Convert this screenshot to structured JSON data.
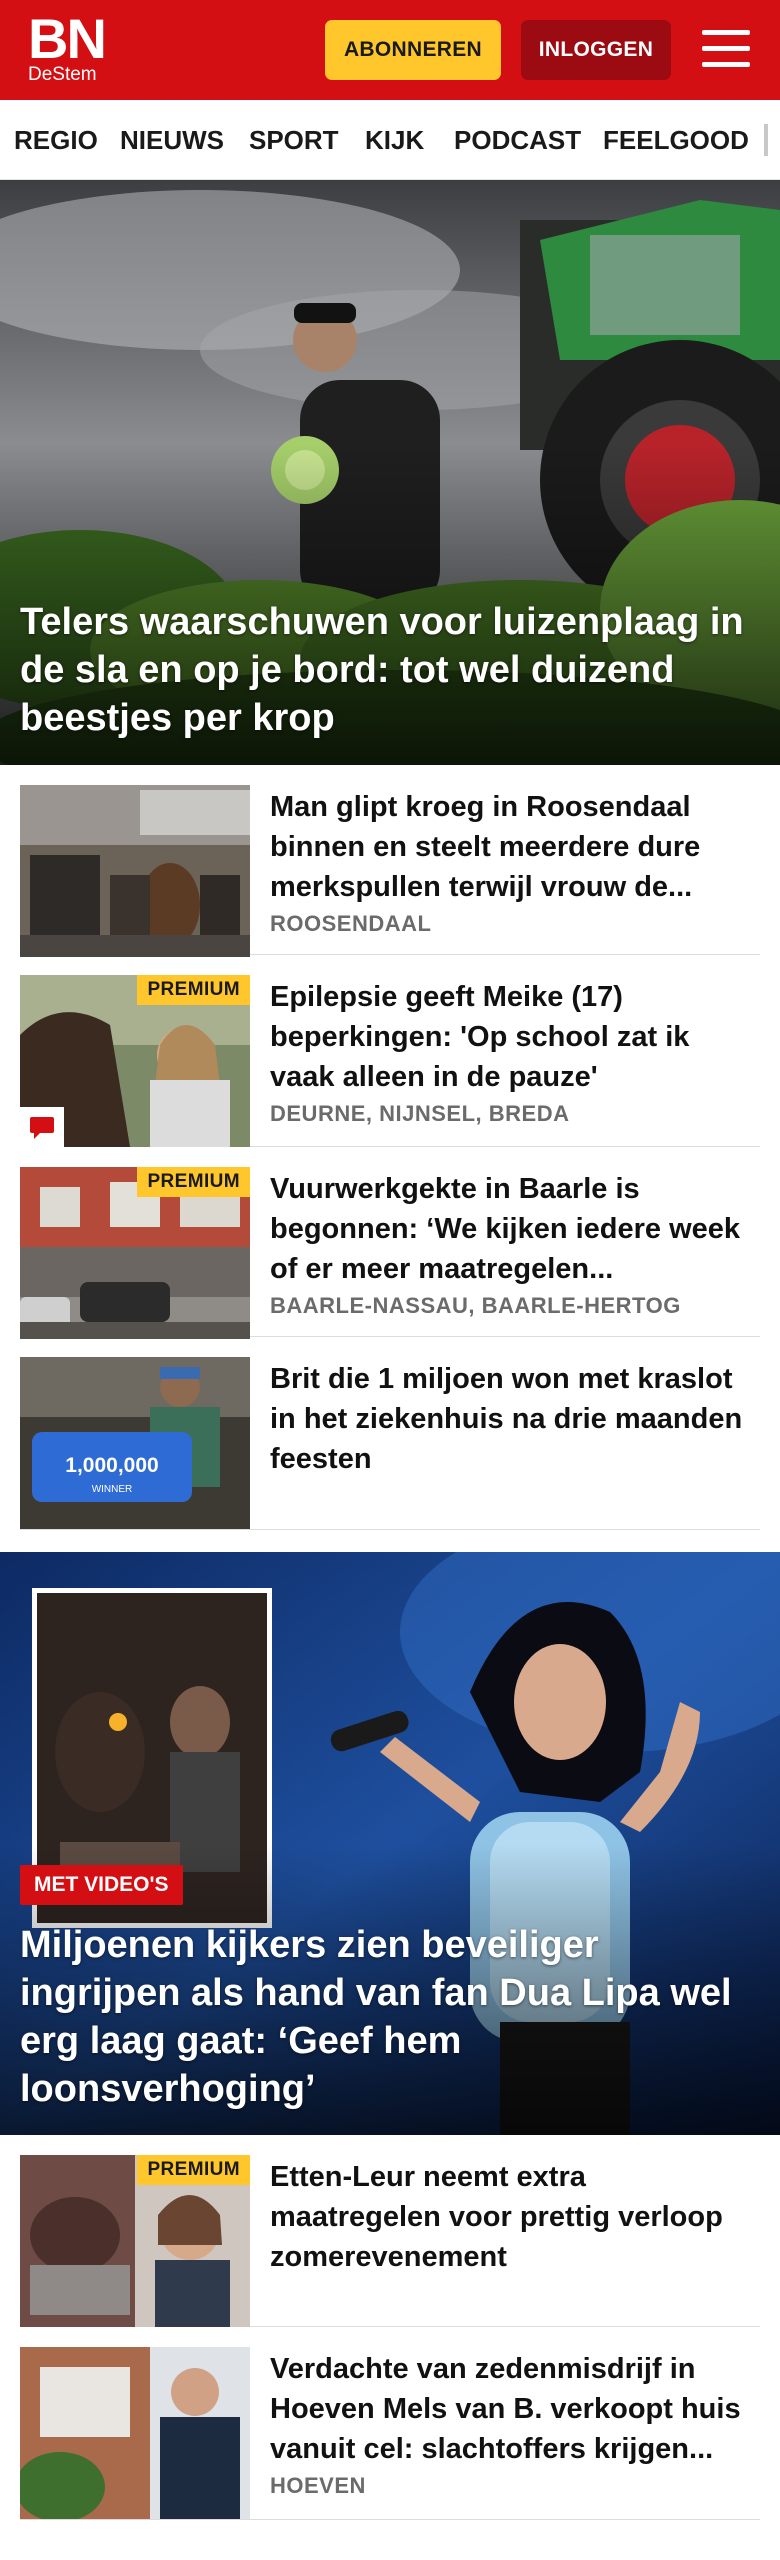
{
  "header": {
    "logo_main": "BN",
    "logo_sub": "DeStem",
    "subscribe_label": "ABONNEREN",
    "login_label": "INLOGGEN",
    "menu_icon": "hamburger-menu-icon",
    "brand_color": "#d40f14",
    "subscribe_color": "#ffc72c"
  },
  "nav": {
    "items": [
      {
        "label": "REGIO"
      },
      {
        "label": "NIEUWS"
      },
      {
        "label": "SPORT"
      },
      {
        "label": "KIJK"
      },
      {
        "label": "PODCAST"
      },
      {
        "label": "FEELGOOD"
      }
    ]
  },
  "hero1": {
    "title": "Telers waarschuwen voor luizenplaag in de sla en op je bord: tot wel duizend beestjes per krop"
  },
  "articles1": [
    {
      "title": "Man glipt kroeg in Roosendaal binnen en steelt meerdere dure merkspullen terwijl vrouw de...",
      "location": "ROOSENDAAL",
      "premium": ""
    },
    {
      "title": "Epilepsie geeft Meike (17) beperkingen: 'Op school zat ik vaak alleen in de pauze'",
      "location": "DEURNE, NIJNSEL, BREDA",
      "premium": "PREMIUM"
    },
    {
      "title": "Vuurwerkgekte in Baarle is begonnen: ‘We kijken iedere week of er meer maatregelen...",
      "location": "BAARLE-NASSAU, BAARLE-HERTOG",
      "premium": "PREMIUM"
    },
    {
      "title": "Brit die 1 miljoen won met kraslot in het ziekenhuis na drie maanden feesten",
      "location": "",
      "premium": ""
    }
  ],
  "hero2": {
    "tag": "MET VIDEO'S",
    "title": "Miljoenen kijkers zien beveiliger ingrijpen als hand van fan Dua Lipa wel erg laag gaat: ‘Geef hem loonsverhoging’"
  },
  "articles2": [
    {
      "title": "Etten-Leur neemt extra maatregelen voor prettig verloop zomerevenement",
      "location": "",
      "premium": "PREMIUM"
    },
    {
      "title": "Verdachte van zedenmisdrijf in Hoeven Mels van B. verkoopt huis vanuit cel: slachtoffers krijgen...",
      "location": "HOEVEN",
      "premium": ""
    }
  ],
  "thumb_text": {
    "kraslot": "1,000,000",
    "kraslot_sub": "WINNER"
  }
}
